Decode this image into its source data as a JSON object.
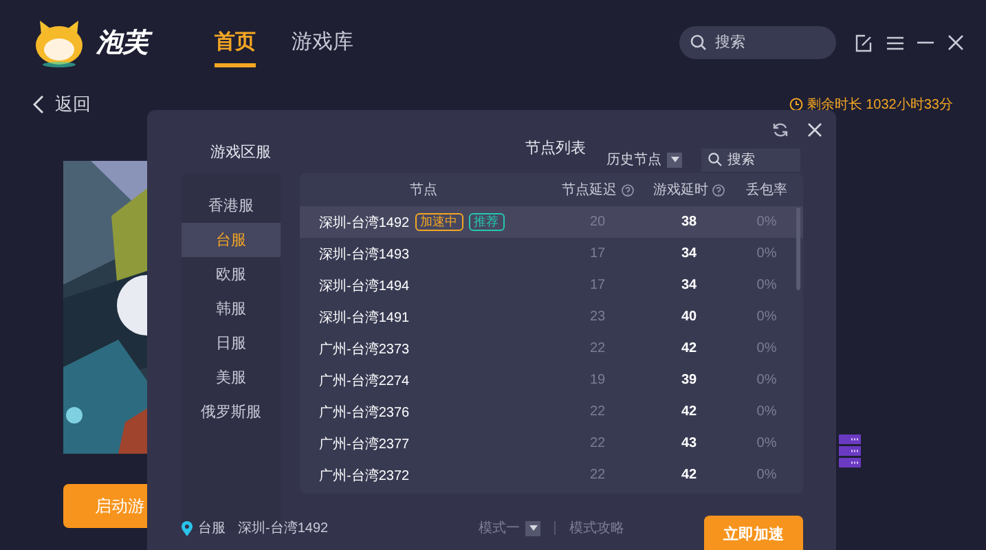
{
  "app": {
    "name": "泡芙"
  },
  "nav": [
    {
      "label": "首页",
      "selected": true
    },
    {
      "label": "游戏库",
      "selected": false
    }
  ],
  "search": {
    "placeholder": "搜索"
  },
  "back": {
    "label": "返回"
  },
  "remaining": "剩余时长 1032小时33分",
  "launch_button": "启动游",
  "dialog": {
    "regions_title": "游戏区服",
    "regions": [
      {
        "label": "香港服",
        "selected": false
      },
      {
        "label": "台服",
        "selected": true
      },
      {
        "label": "欧服",
        "selected": false
      },
      {
        "label": "韩服",
        "selected": false
      },
      {
        "label": "日服",
        "selected": false
      },
      {
        "label": "美服",
        "selected": false
      },
      {
        "label": "俄罗斯服",
        "selected": false
      }
    ],
    "nodes_title": "节点列表",
    "history": "历史节点",
    "search_placeholder": "搜索",
    "columns": [
      {
        "label": "节点",
        "help": false
      },
      {
        "label": "节点延迟",
        "help": true
      },
      {
        "label": "游戏延时",
        "help": true
      },
      {
        "label": "丢包率",
        "help": false
      }
    ],
    "rows": [
      {
        "node": "深圳-台湾1492",
        "tags": [
          {
            "label": "加速中",
            "kind": "active"
          },
          {
            "label": "推荐",
            "kind": "recommended"
          }
        ],
        "ping": "20",
        "game_latency": "38",
        "loss": "0%",
        "selected": true
      },
      {
        "node": "深圳-台湾1493",
        "ping": "17",
        "game_latency": "34",
        "loss": "0%",
        "selected": false
      },
      {
        "node": "深圳-台湾1494",
        "ping": "17",
        "game_latency": "34",
        "loss": "0%",
        "selected": false
      },
      {
        "node": "深圳-台湾1491",
        "ping": "23",
        "game_latency": "40",
        "loss": "0%",
        "selected": false
      },
      {
        "node": "广州-台湾2373",
        "ping": "22",
        "game_latency": "42",
        "loss": "0%",
        "selected": false
      },
      {
        "node": "广州-台湾2274",
        "ping": "19",
        "game_latency": "39",
        "loss": "0%",
        "selected": false
      },
      {
        "node": "广州-台湾2376",
        "ping": "22",
        "game_latency": "42",
        "loss": "0%",
        "selected": false
      },
      {
        "node": "广州-台湾2377",
        "ping": "22",
        "game_latency": "43",
        "loss": "0%",
        "selected": false
      },
      {
        "node": "广州-台湾2372",
        "ping": "22",
        "game_latency": "42",
        "loss": "0%",
        "selected": false
      }
    ],
    "footer": {
      "region": "台服",
      "node": "深圳-台湾1492",
      "mode": "模式一",
      "guide": "模式攻略",
      "button": "立即加速"
    }
  }
}
